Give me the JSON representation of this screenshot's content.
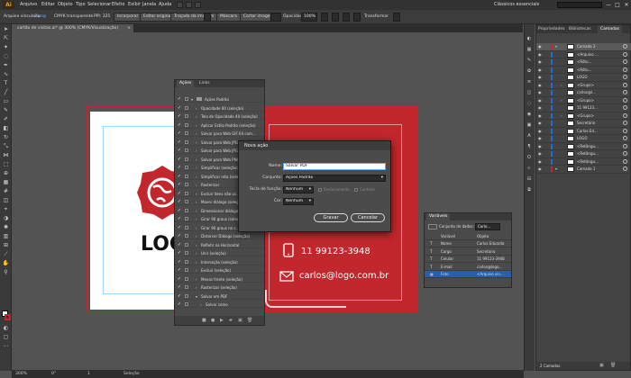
{
  "app": {
    "logo": "Ai",
    "menu": [
      "Arquivo",
      "Editar",
      "Objeto",
      "Tipo",
      "Selecionar",
      "Efeito",
      "Exibir",
      "Janela",
      "Ajuda"
    ],
    "workspace": "Clássicos essenciais",
    "window_buttons": [
      "—",
      "□",
      "✕"
    ]
  },
  "control_bar": {
    "selection": "Arquivo vinculado",
    "filename": "2.png",
    "color_info": "CMYK transparente",
    "ppi": "PPI: 325",
    "buttons": [
      "Incorporar",
      "Editar original",
      "Traçado da imagem",
      "Máscara",
      "Cortar imagem",
      "Opacidade",
      "Transformar"
    ],
    "opacity": "100%"
  },
  "document": {
    "tab_title": "cartão de visitas.ai* @ 300% (CMYK/Visualização)",
    "close": "×"
  },
  "card": {
    "logo_text": "LOGO",
    "phone": "11 99123-3948",
    "email": "carlos@logo.com.br"
  },
  "actions_panel": {
    "tabs": [
      "Ações",
      "Links"
    ],
    "rows": [
      {
        "checked": true,
        "box": true,
        "arrow": "▾",
        "folder": true,
        "label": "Ações Padrão",
        "indent": 0
      },
      {
        "checked": true,
        "box": false,
        "arrow": "›",
        "label": "Opacidade 60 (seleção)",
        "indent": 1
      },
      {
        "checked": true,
        "box": false,
        "arrow": "›",
        "label": "Tela de Opacidade 40 (seleção)",
        "indent": 1
      },
      {
        "checked": true,
        "box": false,
        "arrow": "›",
        "label": "Aplicar Estilo Padrão (seleção)",
        "indent": 1
      },
      {
        "checked": true,
        "box": false,
        "arrow": "›",
        "label": "Salvar para Web GIF 64 com...",
        "indent": 1
      },
      {
        "checked": true,
        "box": false,
        "arrow": "›",
        "label": "Salvar para Web JPG Alto",
        "indent": 1
      },
      {
        "checked": true,
        "box": false,
        "arrow": "›",
        "label": "Salvar para Web JPG Médio",
        "indent": 1
      },
      {
        "checked": true,
        "box": false,
        "arrow": "›",
        "label": "Salvar para Web PNG-24",
        "indent": 1
      },
      {
        "checked": true,
        "box": false,
        "arrow": "›",
        "label": "Simplificar (seleção)",
        "indent": 1
      },
      {
        "checked": true,
        "box": false,
        "arrow": "›",
        "label": "Simplificar reta (seleção)",
        "indent": 1
      },
      {
        "checked": true,
        "box": false,
        "arrow": "›",
        "label": "Rasterizar",
        "indent": 1
      },
      {
        "checked": true,
        "box": false,
        "arrow": "›",
        "label": "Excluir itens não us...",
        "indent": 1
      },
      {
        "checked": true,
        "box": false,
        "arrow": "›",
        "label": "Mover diálogo (seleção)",
        "indent": 1
      },
      {
        "checked": true,
        "box": false,
        "arrow": "›",
        "label": "Dimensionar diálogo (seleção)",
        "indent": 1
      },
      {
        "checked": true,
        "box": false,
        "arrow": "›",
        "label": "Girar 90 graus (seleção)",
        "indent": 1
      },
      {
        "checked": true,
        "box": false,
        "arrow": "›",
        "label": "Girar 90 graus no s...",
        "indent": 1
      },
      {
        "checked": true,
        "box": false,
        "arrow": "›",
        "label": "Distorcer Diálogo (seleção)",
        "indent": 1
      },
      {
        "checked": true,
        "box": false,
        "arrow": "›",
        "label": "Refletir na Horizontal",
        "indent": 1
      },
      {
        "checked": true,
        "box": false,
        "arrow": "›",
        "label": "Unir (seleção)",
        "indent": 1
      },
      {
        "checked": true,
        "box": false,
        "arrow": "›",
        "label": "Interseção (seleção)",
        "indent": 1
      },
      {
        "checked": true,
        "box": false,
        "arrow": "›",
        "label": "Excluir (seleção)",
        "indent": 1
      },
      {
        "checked": true,
        "box": false,
        "arrow": "›",
        "label": "Menos frente (seleção)",
        "indent": 1
      },
      {
        "checked": true,
        "box": false,
        "arrow": "›",
        "label": "Rasterizar (seleção)",
        "indent": 1
      },
      {
        "checked": true,
        "box": false,
        "arrow": "▾",
        "label": "Salvar em PDF",
        "indent": 1
      },
      {
        "checked": true,
        "box": false,
        "arrow": "›",
        "label": "Salvar como",
        "indent": 2
      }
    ]
  },
  "dialog": {
    "title": "Nova ação",
    "name_label": "Nome:",
    "name_value": "Salvar PDF",
    "set_label": "Conjunto:",
    "set_value": "Ações Padrão",
    "fkey_label": "Tecla de função:",
    "fkey_value": "Nenhum",
    "shift_label": "Deslocamento",
    "ctrl_label": "Controle",
    "color_label": "Cor:",
    "color_value": "Nenhum",
    "save_button": "Gravar",
    "cancel_button": "Cancelar"
  },
  "layers_panel": {
    "tabs": [
      "Propriedades",
      "Bibliotecas",
      "Camadas"
    ],
    "rows": [
      {
        "label": "Camada 2",
        "level": 0,
        "selected": true
      },
      {
        "label": "<Arquivo ...",
        "level": 1
      },
      {
        "label": "<Rótu...",
        "level": 1
      },
      {
        "label": "<Rótu...",
        "level": 1
      },
      {
        "label": "LOGO",
        "level": 1
      },
      {
        "label": "<Grupo>",
        "level": 1
      },
      {
        "label": "carlos@l...",
        "level": 1
      },
      {
        "label": "<Grupo>",
        "level": 1
      },
      {
        "label": "11 99123...",
        "level": 1
      },
      {
        "label": "<Grupo>",
        "level": 1
      },
      {
        "label": "Secretário",
        "level": 1
      },
      {
        "label": "Carlos Ed...",
        "level": 1
      },
      {
        "label": "LOGO",
        "level": 1
      },
      {
        "label": "<Retângu...",
        "level": 1
      },
      {
        "label": "<Retângu...",
        "level": 1
      },
      {
        "label": "<Retângu...",
        "level": 1
      },
      {
        "label": "Camada 1",
        "level": 0
      }
    ],
    "footer": "2 Camadas"
  },
  "variables_panel": {
    "title": "Variáveis",
    "dataset_label": "Conjunto de dados:",
    "dataset_value": "Carlo...",
    "col1": "Variável",
    "col2": "Objeto",
    "rows": [
      {
        "type": "T",
        "name": "Nome",
        "object": "Carlos Eduardo"
      },
      {
        "type": "T",
        "name": "Cargo",
        "object": "Secretario"
      },
      {
        "type": "T",
        "name": "Celular",
        "object": "11 99123-3948"
      },
      {
        "type": "T",
        "name": "E-mail",
        "object": "carlos@logo..."
      },
      {
        "type": "▦",
        "name": "Foto",
        "object": "<Arquivo vin...",
        "selected": true
      }
    ]
  },
  "status": {
    "zoom": "300%",
    "angle": "0°",
    "page": "1",
    "tool": "Seleção"
  },
  "colors": {
    "accent_red": "#c1272d",
    "selection_blue": "#1a6fd1",
    "ai_orange": "#ff9a00"
  }
}
